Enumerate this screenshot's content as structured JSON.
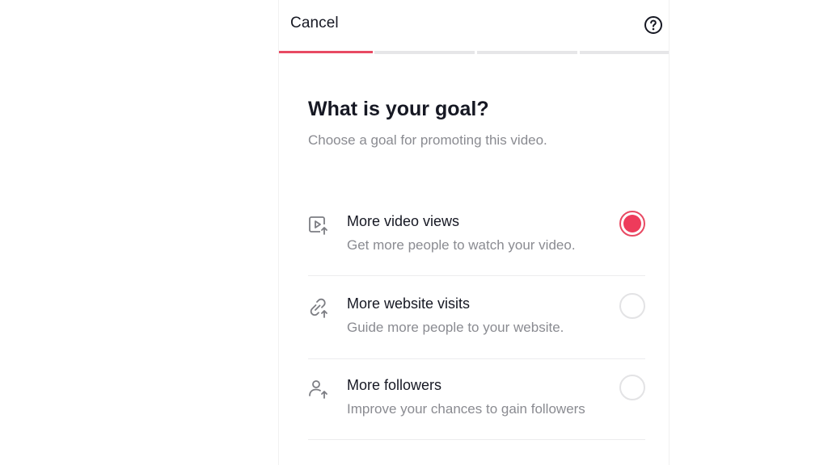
{
  "header": {
    "cancel_label": "Cancel",
    "help_icon": "question-circle-icon"
  },
  "progress": {
    "steps": 4,
    "current_step": 1,
    "active_color": "#e84a63",
    "inactive_color": "#e6e6e8"
  },
  "page": {
    "title": "What is your goal?",
    "subtitle": "Choose a goal for promoting this video."
  },
  "goals": [
    {
      "icon": "video-play-up-icon",
      "title": "More video views",
      "description": "Get more people to watch your video.",
      "selected": true
    },
    {
      "icon": "link-up-icon",
      "title": "More website visits",
      "description": "Guide more people to your website.",
      "selected": false
    },
    {
      "icon": "person-up-icon",
      "title": "More followers",
      "description": "Improve your chances to gain followers",
      "selected": false
    }
  ],
  "colors": {
    "accent": "#ee3b5b",
    "text_primary": "#161823",
    "text_secondary": "#8a8b91"
  }
}
